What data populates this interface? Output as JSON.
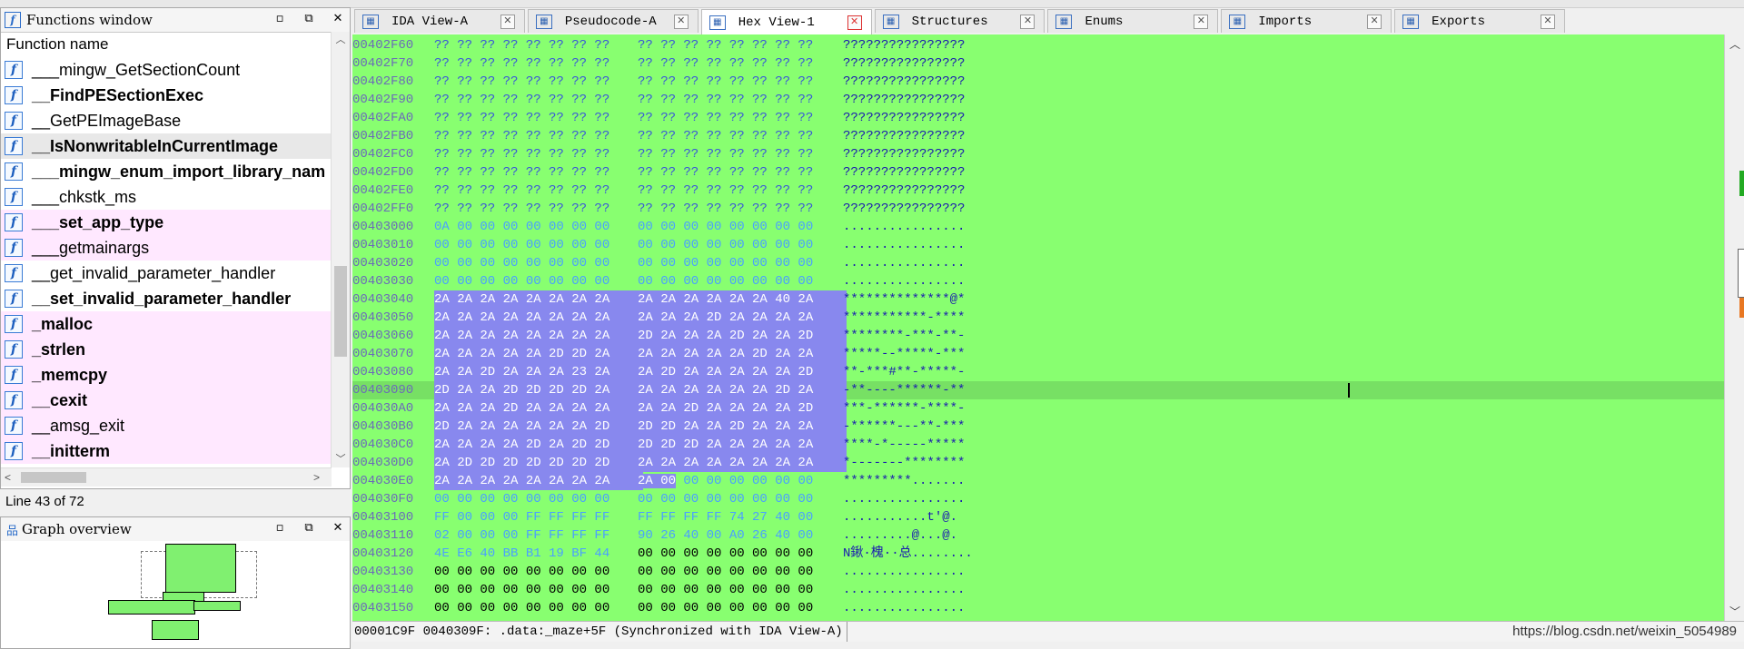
{
  "functions_window": {
    "title": "Functions window",
    "column_header": "Function name",
    "functions": [
      {
        "name": "___mingw_GetSectionCount",
        "bold": false,
        "lib": false,
        "selected": false
      },
      {
        "name": "__FindPESectionExec",
        "bold": true,
        "lib": false,
        "selected": false
      },
      {
        "name": "__GetPEImageBase",
        "bold": false,
        "lib": false,
        "selected": false
      },
      {
        "name": "__IsNonwritableInCurrentImage",
        "bold": true,
        "lib": false,
        "selected": true
      },
      {
        "name": "___mingw_enum_import_library_nam",
        "bold": true,
        "lib": false,
        "selected": false
      },
      {
        "name": "___chkstk_ms",
        "bold": false,
        "lib": false,
        "selected": false
      },
      {
        "name": "___set_app_type",
        "bold": true,
        "lib": true,
        "selected": false
      },
      {
        "name": "___getmainargs",
        "bold": false,
        "lib": true,
        "selected": false
      },
      {
        "name": "__get_invalid_parameter_handler",
        "bold": false,
        "lib": false,
        "selected": false
      },
      {
        "name": "__set_invalid_parameter_handler",
        "bold": true,
        "lib": false,
        "selected": false
      },
      {
        "name": "_malloc",
        "bold": true,
        "lib": true,
        "selected": false
      },
      {
        "name": "_strlen",
        "bold": true,
        "lib": true,
        "selected": false
      },
      {
        "name": "_memcpy",
        "bold": true,
        "lib": true,
        "selected": false
      },
      {
        "name": "__cexit",
        "bold": true,
        "lib": true,
        "selected": false
      },
      {
        "name": "__amsg_exit",
        "bold": false,
        "lib": true,
        "selected": false
      },
      {
        "name": "__initterm",
        "bold": true,
        "lib": true,
        "selected": false
      }
    ],
    "status": "Line 43 of 72"
  },
  "graph_overview": {
    "title": "Graph overview"
  },
  "tabs": [
    {
      "label": "IDA View-A",
      "icon": "ida-view-icon",
      "active": false
    },
    {
      "label": "Pseudocode-A",
      "icon": "pseudocode-icon",
      "active": false
    },
    {
      "label": "Hex View-1",
      "icon": "hex-view-icon",
      "active": true
    },
    {
      "label": "Structures",
      "icon": "structures-icon",
      "active": false
    },
    {
      "label": "Enums",
      "icon": "enums-icon",
      "active": false
    },
    {
      "label": "Imports",
      "icon": "imports-icon",
      "active": false
    },
    {
      "label": "Exports",
      "icon": "exports-icon",
      "active": false
    }
  ],
  "hex_rows": [
    {
      "addr": "00402F60",
      "h1": "?? ?? ?? ?? ?? ?? ?? ??",
      "h2": "?? ?? ?? ?? ?? ?? ?? ??",
      "ascii": "????????????????",
      "kind": "q"
    },
    {
      "addr": "00402F70",
      "h1": "?? ?? ?? ?? ?? ?? ?? ??",
      "h2": "?? ?? ?? ?? ?? ?? ?? ??",
      "ascii": "????????????????",
      "kind": "q"
    },
    {
      "addr": "00402F80",
      "h1": "?? ?? ?? ?? ?? ?? ?? ??",
      "h2": "?? ?? ?? ?? ?? ?? ?? ??",
      "ascii": "????????????????",
      "kind": "q"
    },
    {
      "addr": "00402F90",
      "h1": "?? ?? ?? ?? ?? ?? ?? ??",
      "h2": "?? ?? ?? ?? ?? ?? ?? ??",
      "ascii": "????????????????",
      "kind": "q"
    },
    {
      "addr": "00402FA0",
      "h1": "?? ?? ?? ?? ?? ?? ?? ??",
      "h2": "?? ?? ?? ?? ?? ?? ?? ??",
      "ascii": "????????????????",
      "kind": "q"
    },
    {
      "addr": "00402FB0",
      "h1": "?? ?? ?? ?? ?? ?? ?? ??",
      "h2": "?? ?? ?? ?? ?? ?? ?? ??",
      "ascii": "????????????????",
      "kind": "q"
    },
    {
      "addr": "00402FC0",
      "h1": "?? ?? ?? ?? ?? ?? ?? ??",
      "h2": "?? ?? ?? ?? ?? ?? ?? ??",
      "ascii": "????????????????",
      "kind": "q"
    },
    {
      "addr": "00402FD0",
      "h1": "?? ?? ?? ?? ?? ?? ?? ??",
      "h2": "?? ?? ?? ?? ?? ?? ?? ??",
      "ascii": "????????????????",
      "kind": "q"
    },
    {
      "addr": "00402FE0",
      "h1": "?? ?? ?? ?? ?? ?? ?? ??",
      "h2": "?? ?? ?? ?? ?? ?? ?? ??",
      "ascii": "????????????????",
      "kind": "q"
    },
    {
      "addr": "00402FF0",
      "h1": "?? ?? ?? ?? ?? ?? ?? ??",
      "h2": "?? ?? ?? ?? ?? ?? ?? ??",
      "ascii": "????????????????",
      "kind": "q"
    },
    {
      "addr": "00403000",
      "h1": "0A 00 00 00 00 00 00 00",
      "h2": "00 00 00 00 00 00 00 00",
      "ascii": "................",
      "kind": "z"
    },
    {
      "addr": "00403010",
      "h1": "00 00 00 00 00 00 00 00",
      "h2": "00 00 00 00 00 00 00 00",
      "ascii": "................",
      "kind": "z"
    },
    {
      "addr": "00403020",
      "h1": "00 00 00 00 00 00 00 00",
      "h2": "00 00 00 00 00 00 00 00",
      "ascii": "................",
      "kind": "z"
    },
    {
      "addr": "00403030",
      "h1": "00 00 00 00 00 00 00 00",
      "h2": "00 00 00 00 00 00 00 00",
      "ascii": "................",
      "kind": "z"
    },
    {
      "addr": "00403040",
      "h1": "2A 2A 2A 2A 2A 2A 2A 2A",
      "h2": "2A 2A 2A 2A 2A 2A 40 2A",
      "ascii": "**************@*",
      "kind": "sel"
    },
    {
      "addr": "00403050",
      "h1": "2A 2A 2A 2A 2A 2A 2A 2A",
      "h2": "2A 2A 2A 2D 2A 2A 2A 2A",
      "ascii": "***********-****",
      "kind": "sel"
    },
    {
      "addr": "00403060",
      "h1": "2A 2A 2A 2A 2A 2A 2A 2A",
      "h2": "2D 2A 2A 2A 2D 2A 2A 2D",
      "ascii": "********-***-**-",
      "kind": "sel"
    },
    {
      "addr": "00403070",
      "h1": "2A 2A 2A 2A 2A 2D 2D 2A",
      "h2": "2A 2A 2A 2A 2A 2D 2A 2A",
      "ascii": "*****--*****-***",
      "kind": "sel"
    },
    {
      "addr": "00403080",
      "h1": "2A 2A 2D 2A 2A 2A 23 2A",
      "h2": "2A 2D 2A 2A 2A 2A 2A 2D",
      "ascii": "**-***#**-*****-",
      "kind": "sel"
    },
    {
      "addr": "00403090",
      "h1": "2D 2A 2A 2D 2D 2D 2D 2A",
      "h2": "2A 2A 2A 2A 2A 2A 2D 2A",
      "ascii": "-**----******-**",
      "kind": "sel",
      "current": true
    },
    {
      "addr": "004030A0",
      "h1": "2A 2A 2A 2D 2A 2A 2A 2A",
      "h2": "2A 2A 2D 2A 2A 2A 2A 2D",
      "ascii": "***-******-****-",
      "kind": "sel"
    },
    {
      "addr": "004030B0",
      "h1": "2D 2A 2A 2A 2A 2A 2A 2D",
      "h2": "2D 2D 2A 2A 2D 2A 2A 2A",
      "ascii": "-******---**-***",
      "kind": "sel"
    },
    {
      "addr": "004030C0",
      "h1": "2A 2A 2A 2A 2D 2A 2D 2D",
      "h2": "2D 2D 2D 2A 2A 2A 2A 2A",
      "ascii": "****-*-----*****",
      "kind": "sel"
    },
    {
      "addr": "004030D0",
      "h1": "2A 2D 2D 2D 2D 2D 2D 2D",
      "h2": "2A 2A 2A 2A 2A 2A 2A 2A",
      "ascii": "*-------********",
      "kind": "sel"
    },
    {
      "addr": "004030E0",
      "h1": "2A 2A 2A 2A 2A 2A 2A 2A",
      "h2": "2A 00 00 00 00 00 00 00",
      "ascii": "*********.......",
      "kind": "selpart"
    },
    {
      "addr": "004030F0",
      "h1": "00 00 00 00 00 00 00 00",
      "h2": "00 00 00 00 00 00 00 00",
      "ascii": "................",
      "kind": "z"
    },
    {
      "addr": "00403100",
      "h1": "FF 00 00 00 FF FF FF FF",
      "h2": "FF FF FF FF 74 27 40 00",
      "ascii": "...........t'@.",
      "kind": "z"
    },
    {
      "addr": "00403110",
      "h1": "02 00 00 00 FF FF FF FF",
      "h2": "90 26 40 00 A0 26 40 00",
      "ascii": ".........@...@.",
      "kind": "z"
    },
    {
      "addr": "00403120",
      "h1": "4E E6 40 BB B1 19 BF 44",
      "h2": "00 00 00 00 00 00 00 00",
      "ascii": "N鍬·槐··总........",
      "kind": "mix"
    },
    {
      "addr": "00403130",
      "h1": "00 00 00 00 00 00 00 00",
      "h2": "00 00 00 00 00 00 00 00",
      "ascii": "................",
      "kind": "dark"
    },
    {
      "addr": "00403140",
      "h1": "00 00 00 00 00 00 00 00",
      "h2": "00 00 00 00 00 00 00 00",
      "ascii": "................",
      "kind": "dark"
    },
    {
      "addr": "00403150",
      "h1": "00 00 00 00 00 00 00 00",
      "h2": "00 00 00 00 00 00 00 00",
      "ascii": "................",
      "kind": "dark"
    }
  ],
  "hex_status": "00001C9F 0040309F: .data:_maze+5F (Synchronized with IDA View-A)",
  "watermark": "https://blog.csdn.net/weixin_5054989",
  "colors": {
    "hex_background": "#88ff70",
    "selection": "#8888ee",
    "library_function": "#ffe8ff"
  }
}
